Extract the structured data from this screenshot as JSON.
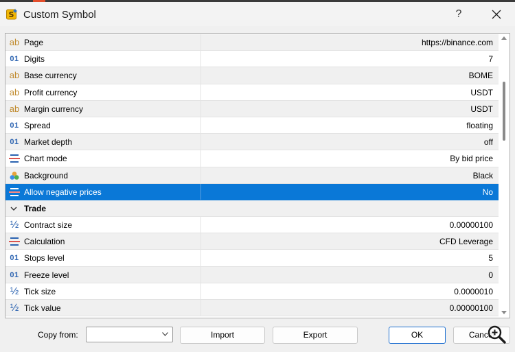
{
  "window": {
    "title": "Custom Symbol",
    "help_label": "?"
  },
  "rows": [
    {
      "icon": "ab",
      "label": "Page",
      "value": "https://binance.com"
    },
    {
      "icon": "01",
      "label": "Digits",
      "value": "7"
    },
    {
      "icon": "ab",
      "label": "Base currency",
      "value": "BOME"
    },
    {
      "icon": "ab",
      "label": "Profit currency",
      "value": "USDT"
    },
    {
      "icon": "ab",
      "label": "Margin currency",
      "value": "USDT"
    },
    {
      "icon": "01",
      "label": "Spread",
      "value": "floating"
    },
    {
      "icon": "01",
      "label": "Market depth",
      "value": "off"
    },
    {
      "icon": "enum",
      "label": "Chart mode",
      "value": "By bid price"
    },
    {
      "icon": "color",
      "label": "Background",
      "value": "Black"
    },
    {
      "icon": "enum",
      "label": "Allow negative prices",
      "value": "No",
      "selected": true
    }
  ],
  "trade_group": {
    "label": "Trade"
  },
  "trade_rows": [
    {
      "icon": "frac",
      "label": "Contract size",
      "value": "0.00000100"
    },
    {
      "icon": "enum",
      "label": "Calculation",
      "value": "CFD Leverage"
    },
    {
      "icon": "01",
      "label": "Stops level",
      "value": "5"
    },
    {
      "icon": "01",
      "label": "Freeze level",
      "value": "0"
    },
    {
      "icon": "frac",
      "label": "Tick size",
      "value": "0.0000010"
    },
    {
      "icon": "frac",
      "label": "Tick value",
      "value": "0.00000100"
    }
  ],
  "footer": {
    "copy_from_label": "Copy from:",
    "copy_from_value": "",
    "import_label": "Import",
    "export_label": "Export",
    "ok_label": "OK",
    "cancel_label": "Cancel"
  },
  "colors": {
    "selection": "#0a78d7",
    "ab_icon": "#c08a2c",
    "numeric_icon": "#2a62b0"
  }
}
